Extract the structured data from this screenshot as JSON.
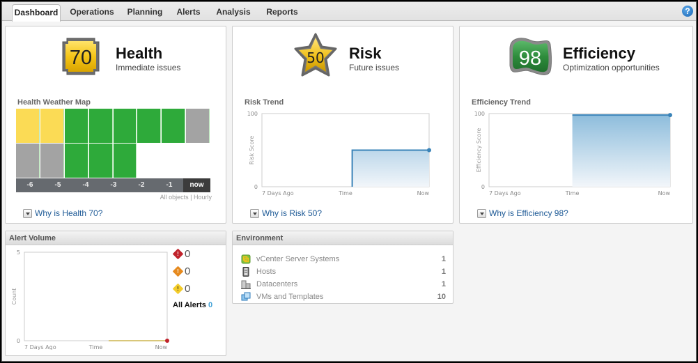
{
  "tabs": [
    {
      "label": "Dashboard",
      "active": true
    },
    {
      "label": "Operations",
      "active": false
    },
    {
      "label": "Planning",
      "active": false
    },
    {
      "label": "Alerts",
      "active": false
    },
    {
      "label": "Analysis",
      "active": false
    },
    {
      "label": "Reports",
      "active": false
    }
  ],
  "help_icon": "?",
  "health": {
    "score": "70",
    "title": "Health",
    "subtitle": "Immediate issues",
    "badge_color": "#f2c21a",
    "map_title": "Health Weather Map",
    "map_rows": [
      [
        "yellow",
        "yellow",
        "green",
        "green",
        "green",
        "green",
        "green",
        "grey"
      ],
      [
        "grey",
        "grey",
        "green",
        "green",
        "green",
        "empty",
        "empty",
        "empty"
      ]
    ],
    "map_colors": {
      "yellow": "#fbdb55",
      "green": "#2eaa3a",
      "grey": "#a3a3a3",
      "empty": "#ffffff"
    },
    "time_labels": [
      "-6",
      "-5",
      "-4",
      "-3",
      "-2",
      "-1",
      "now"
    ],
    "map_footer": "All objects | Hourly",
    "why_link": "Why is Health 70?"
  },
  "risk": {
    "score": "50",
    "title": "Risk",
    "subtitle": "Future issues",
    "trend_title": "Risk Trend",
    "why_link": "Why is Risk 50?"
  },
  "efficiency": {
    "score": "98",
    "title": "Efficiency",
    "subtitle": "Optimization opportunities",
    "trend_title": "Efficiency Trend",
    "why_link": "Why is Efficiency 98?"
  },
  "alert_volume": {
    "title": "Alert Volume",
    "critical": "0",
    "immediate": "0",
    "warning": "0",
    "all_alerts_label": "All Alerts",
    "all_alerts_count": "0"
  },
  "environment": {
    "title": "Environment",
    "items": [
      {
        "label": "vCenter Server Systems",
        "count": "1",
        "icon": "vcenter-icon"
      },
      {
        "label": "Hosts",
        "count": "1",
        "icon": "host-icon"
      },
      {
        "label": "Datacenters",
        "count": "1",
        "icon": "datacenter-icon"
      },
      {
        "label": "VMs and Templates",
        "count": "10",
        "icon": "vm-icon"
      }
    ]
  },
  "chart_data": [
    {
      "type": "area",
      "title": "Risk Trend",
      "xlabel": "Time",
      "ylabel": "Risk Score",
      "x_ticks": [
        "7 Days Ago",
        "Time",
        "Now"
      ],
      "y_ticks": [
        "100",
        "0"
      ],
      "ylim": [
        0,
        100
      ],
      "xlim": [
        0,
        1
      ],
      "series": [
        {
          "name": "Risk Score",
          "x": [
            0.54,
            1.0
          ],
          "y": [
            50,
            50
          ],
          "color": "#3a83b8"
        }
      ]
    },
    {
      "type": "area",
      "title": "Efficiency Trend",
      "xlabel": "Time",
      "ylabel": "Efficiency Score",
      "x_ticks": [
        "7 Days Ago",
        "Time",
        "Now"
      ],
      "y_ticks": [
        "100",
        "0"
      ],
      "ylim": [
        0,
        100
      ],
      "xlim": [
        0,
        1
      ],
      "series": [
        {
          "name": "Efficiency Score",
          "x": [
            0.46,
            1.0
          ],
          "y": [
            98,
            98
          ],
          "color": "#3a83b8"
        }
      ]
    },
    {
      "type": "line",
      "title": "Alert Volume",
      "xlabel": "Time",
      "ylabel": "Count",
      "x_ticks": [
        "7 Days Ago",
        "Time",
        "Now"
      ],
      "y_ticks": [
        "5",
        "0"
      ],
      "ylim": [
        0,
        5
      ],
      "xlim": [
        0,
        1
      ],
      "series": [
        {
          "name": "Alerts",
          "x": [
            0.59,
            1.0
          ],
          "y": [
            0,
            0
          ],
          "color": "#d9c77a"
        }
      ]
    }
  ]
}
